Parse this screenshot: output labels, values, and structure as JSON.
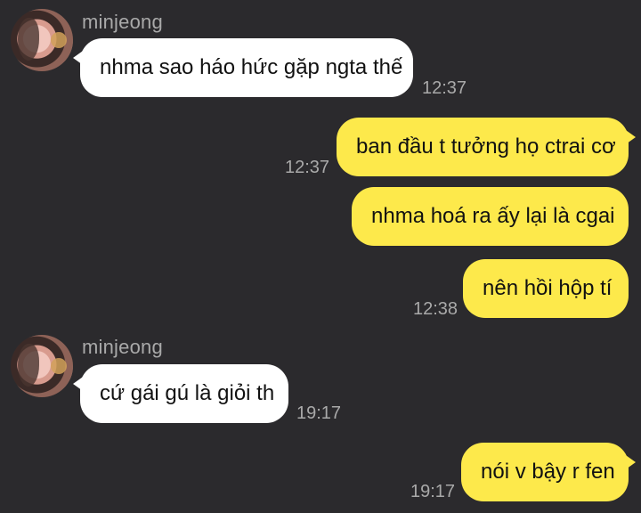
{
  "messages": [
    {
      "sender": "minjeong",
      "text": "nhma sao háo hức gặp ngta thế",
      "time": "12:37"
    },
    {
      "text": "ban đầu t tưởng họ ctrai cơ",
      "time": "12:37"
    },
    {
      "text": "nhma hoá ra ấy lại là cgai"
    },
    {
      "text": "nên hồi hộp tí",
      "time": "12:38"
    },
    {
      "sender": "minjeong",
      "text": "cứ gái gú là giỏi th",
      "time": "19:17"
    },
    {
      "text": "nói v bậy r fen",
      "time": "19:17"
    }
  ],
  "colors": {
    "background": "#2b2a2d",
    "incoming_bubble": "#ffffff",
    "outgoing_bubble": "#fde94b",
    "meta_text": "#a9a9a9"
  },
  "icons": {
    "avatar": "profile-photo"
  }
}
